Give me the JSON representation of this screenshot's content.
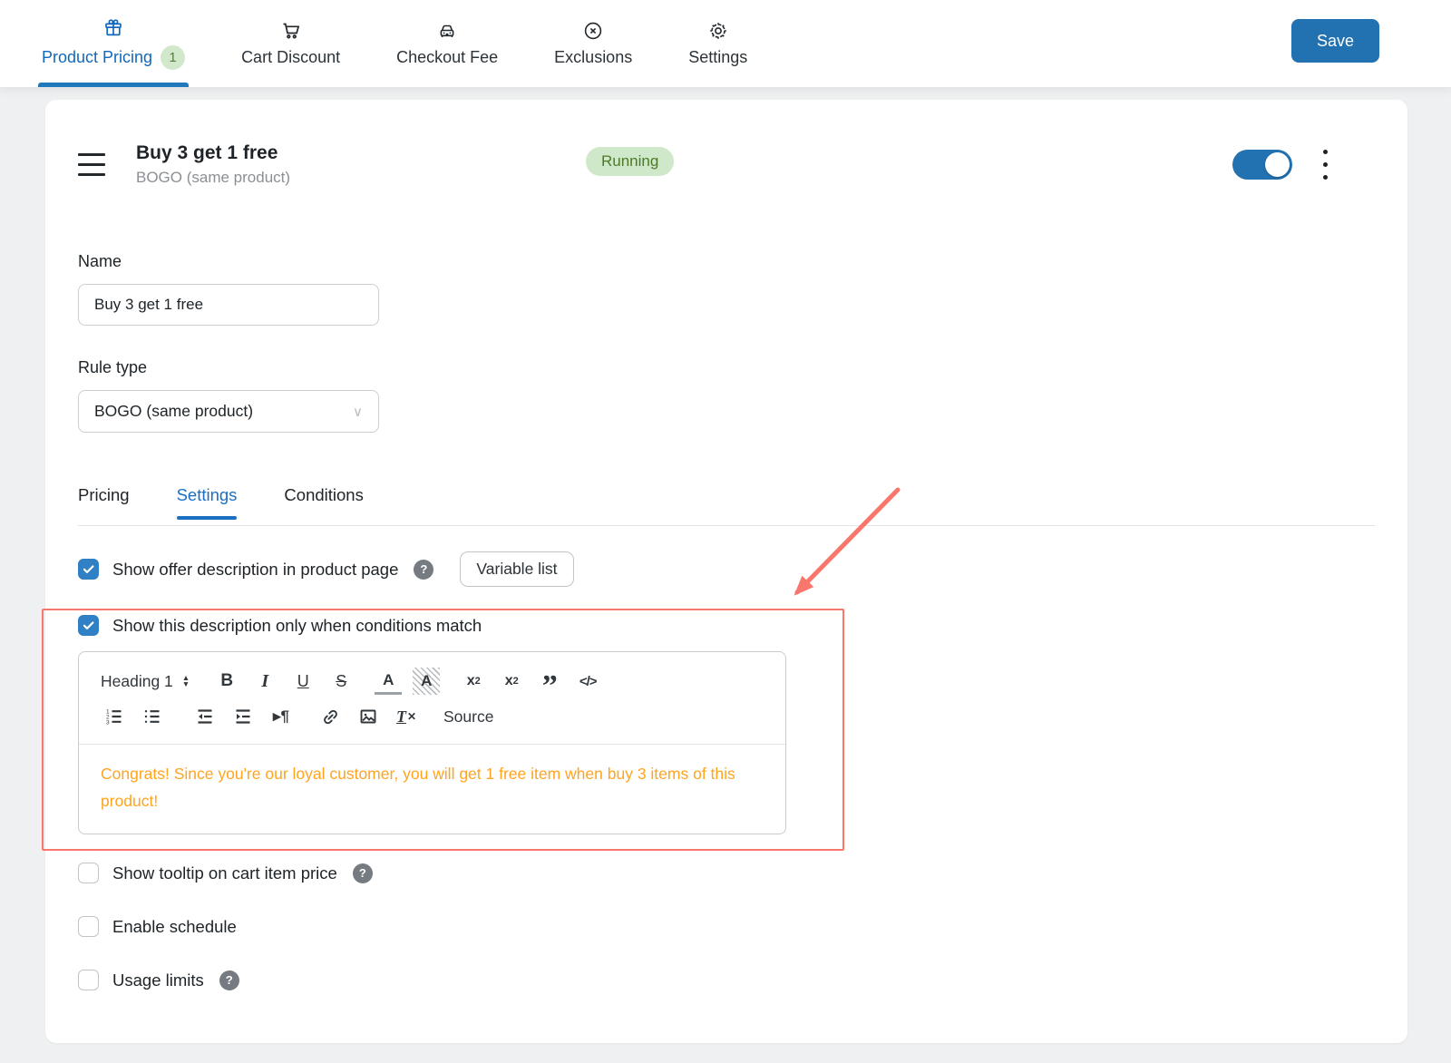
{
  "topnav": {
    "tabs": [
      {
        "label": "Product Pricing",
        "badge": "1"
      },
      {
        "label": "Cart Discount"
      },
      {
        "label": "Checkout Fee"
      },
      {
        "label": "Exclusions"
      },
      {
        "label": "Settings"
      }
    ],
    "save_label": "Save"
  },
  "rule_header": {
    "title": "Buy 3 get 1 free",
    "subtitle": "BOGO (same product)",
    "status_badge": "Running"
  },
  "form": {
    "name_label": "Name",
    "name_value": "Buy 3 get 1 free",
    "rule_type_label": "Rule type",
    "rule_type_value": "BOGO (same product)"
  },
  "subtabs": {
    "pricing": "Pricing",
    "settings": "Settings",
    "conditions": "Conditions"
  },
  "options": {
    "show_offer_description": "Show offer description in product page",
    "variable_list_button": "Variable list",
    "show_description_conditions": "Show this description only when conditions match",
    "show_tooltip": "Show tooltip on cart item price",
    "enable_schedule": "Enable schedule",
    "usage_limits": "Usage limits"
  },
  "editor": {
    "heading_dropdown": "Heading 1",
    "source_button": "Source",
    "content": "Congrats! Since you're our loyal customer, you will get 1 free item when buy 3 items of this product!"
  },
  "colors": {
    "accent_blue": "#2271b1",
    "nav_active_blue": "#1268bb",
    "status_green_bg": "#cfe8c9",
    "status_green_text": "#4c7a28",
    "annotation_red": "#f8766b",
    "editor_text_orange": "#ffa41f"
  }
}
